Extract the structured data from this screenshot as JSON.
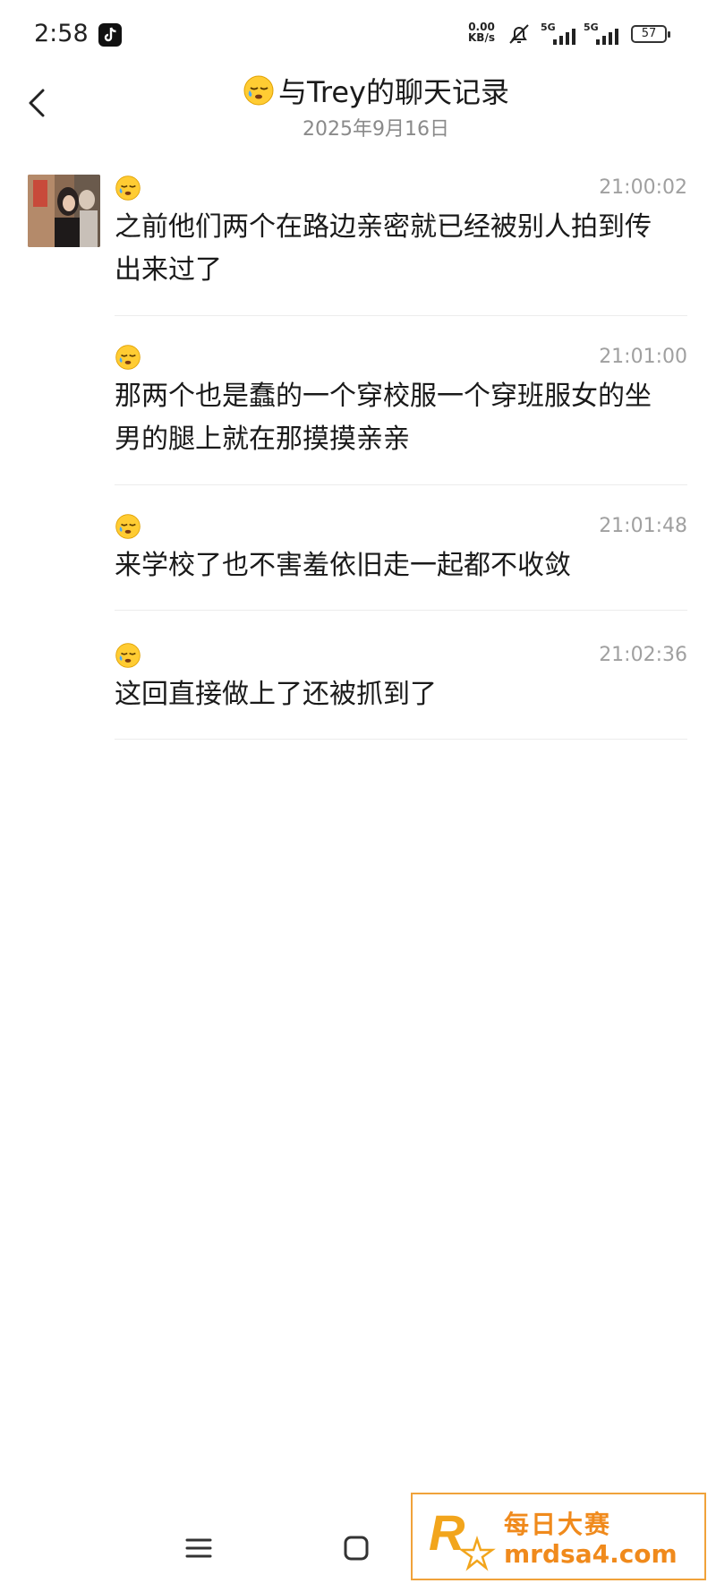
{
  "status_bar": {
    "time": "2:58",
    "net_speed_value": "0.00",
    "net_speed_unit": "KB/s",
    "signal1_label": "5G",
    "signal2_label": "5G",
    "battery": "57"
  },
  "header": {
    "title": "与Trey的聊天记录",
    "date": "2025年9月16日"
  },
  "messages": [
    {
      "time": "21:00:02",
      "text": "之前他们两个在路边亲密就已经被别人拍到传出来过了"
    },
    {
      "time": "21:01:00",
      "text": "那两个也是蠢的一个穿校服一个穿班服女的坐男的腿上就在那摸摸亲亲"
    },
    {
      "time": "21:01:48",
      "text": "来学校了也不害羞依旧走一起都不收敛"
    },
    {
      "time": "21:02:36",
      "text": "这回直接做上了还被抓到了"
    }
  ],
  "watermark": {
    "line1": "每日大赛",
    "line2": "mrdsa4.com"
  },
  "colors": {
    "background": "#ffffff",
    "timestamp": "#a0a0a0",
    "watermark": "#f08a1c"
  },
  "icons": [
    "back-arrow-icon",
    "sleepy-face-emoji-icon",
    "menu-icon",
    "home-icon",
    "nav-back-icon",
    "tiktok-icon",
    "bell-off-icon"
  ]
}
